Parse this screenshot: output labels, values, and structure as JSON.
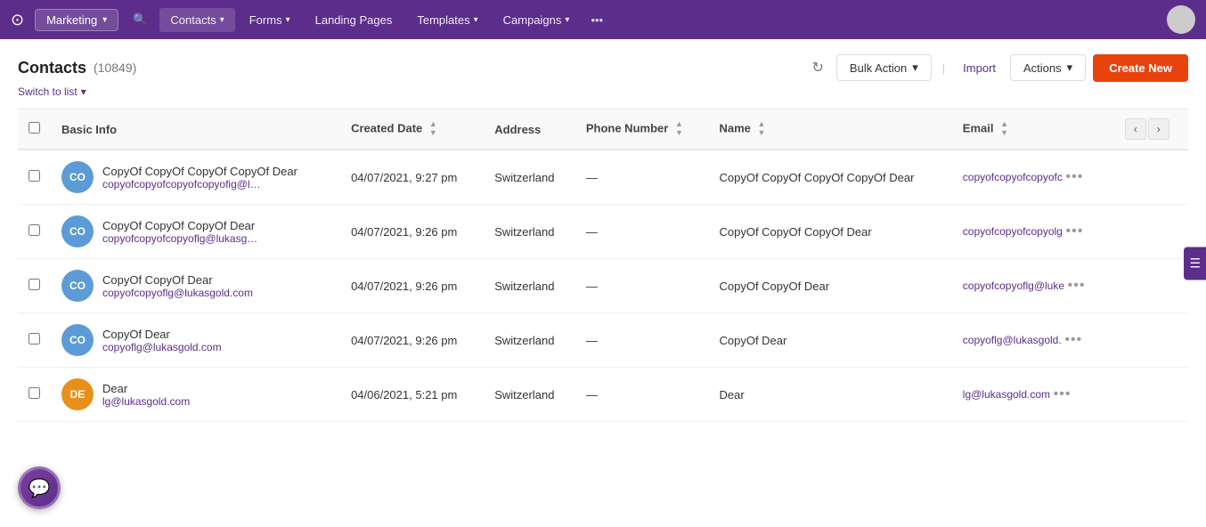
{
  "topnav": {
    "logo_icon": "✓",
    "marketing_label": "Marketing",
    "contacts_label": "Contacts",
    "forms_label": "Forms",
    "landing_pages_label": "Landing Pages",
    "templates_label": "Templates",
    "campaigns_label": "Campaigns",
    "more_label": "•••"
  },
  "page_header": {
    "title": "Contacts",
    "count": "(10849)",
    "switch_to_list": "Switch to list",
    "bulk_action_label": "Bulk Action",
    "import_label": "Import",
    "actions_label": "Actions",
    "create_new_label": "Create New",
    "refresh_icon": "↻"
  },
  "table": {
    "columns": [
      {
        "id": "basic_info",
        "label": "Basic Info",
        "sortable": false
      },
      {
        "id": "created_date",
        "label": "Created Date",
        "sortable": true
      },
      {
        "id": "address",
        "label": "Address",
        "sortable": false
      },
      {
        "id": "phone_number",
        "label": "Phone Number",
        "sortable": true
      },
      {
        "id": "name",
        "label": "Name",
        "sortable": true
      },
      {
        "id": "email",
        "label": "Email",
        "sortable": true
      }
    ],
    "rows": [
      {
        "avatar_initials": "CO",
        "avatar_color": "blue",
        "name": "CopyOf CopyOf CopyOf CopyOf Dear",
        "email": "copyofcopyofcopyofcopyofig@lukasgold.com",
        "created_date": "04/07/2021, 9:27 pm",
        "address": "Switzerland",
        "phone": "—",
        "full_name": "CopyOf CopyOf CopyOf CopyOf Dear",
        "email_display": "copyofcopyofcopyofc"
      },
      {
        "avatar_initials": "CO",
        "avatar_color": "blue",
        "name": "CopyOf CopyOf CopyOf Dear",
        "email": "copyofcopyofcopyoflg@lukasgold.com",
        "created_date": "04/07/2021, 9:26 pm",
        "address": "Switzerland",
        "phone": "—",
        "full_name": "CopyOf CopyOf CopyOf Dear",
        "email_display": "copyofcopyofcopyolg"
      },
      {
        "avatar_initials": "CO",
        "avatar_color": "blue",
        "name": "CopyOf CopyOf Dear",
        "email": "copyofcopyoflg@lukasgold.com",
        "created_date": "04/07/2021, 9:26 pm",
        "address": "Switzerland",
        "phone": "—",
        "full_name": "CopyOf CopyOf Dear",
        "email_display": "copyofcopyoflg@luke"
      },
      {
        "avatar_initials": "CO",
        "avatar_color": "blue",
        "name": "CopyOf Dear",
        "email": "copyoflg@lukasgold.com",
        "created_date": "04/07/2021, 9:26 pm",
        "address": "Switzerland",
        "phone": "—",
        "full_name": "CopyOf Dear",
        "email_display": "copyoflg@lukasgold."
      },
      {
        "avatar_initials": "DE",
        "avatar_color": "orange",
        "name": "Dear",
        "email": "lg@lukasgold.com",
        "created_date": "04/06/2021, 5:21 pm",
        "address": "Switzerland",
        "phone": "—",
        "full_name": "Dear",
        "email_display": "lg@lukasgold.com"
      }
    ]
  }
}
